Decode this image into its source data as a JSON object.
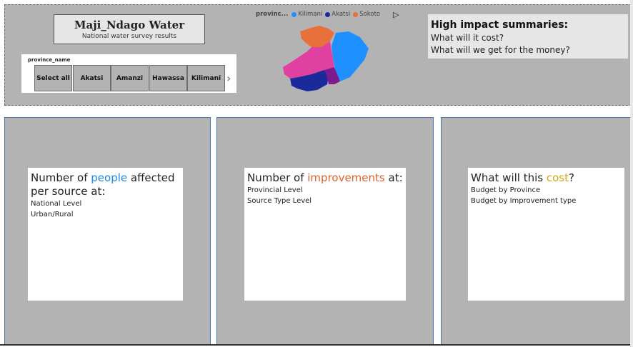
{
  "header": {
    "title": "Maji_Ndago Water",
    "subtitle": "National water survey results"
  },
  "slicer": {
    "label": "province_name",
    "options": [
      "Select all",
      "Akatsi",
      "Amanzi",
      "Hawassa",
      "Kilimani"
    ],
    "scroll_icon": "chevron-right-icon"
  },
  "map_legend": {
    "title": "provinc...",
    "items": [
      {
        "label": "Kilimani",
        "color": "#1e90ff"
      },
      {
        "label": "Akatsi",
        "color": "#1a2a9a"
      },
      {
        "label": "Sokoto",
        "color": "#e8703a"
      }
    ],
    "next_icon": "play-icon"
  },
  "map_colors": {
    "sokoto": "#e8703a",
    "kilimani": "#1e90ff",
    "pink": "#e040a0",
    "akatsi": "#1a2a9a",
    "purple": "#7a1c8c"
  },
  "summaries": {
    "title": "High impact summaries:",
    "lines": [
      "What will it cost?",
      "What will we get for the money?"
    ]
  },
  "cards": [
    {
      "head_pre": "Number of ",
      "head_hl": "people",
      "head_post": " affected per source at:",
      "lines": [
        "National Level",
        "Urban/Rural"
      ]
    },
    {
      "head_pre": "Number of ",
      "head_hl": "improvements",
      "head_post": " at:",
      "lines": [
        "Provincial Level",
        "Source Type Level"
      ]
    },
    {
      "head_pre": "What will this ",
      "head_hl": "cost",
      "head_post": "?",
      "lines": [
        "Budget by Province",
        "Budget by Improvement type"
      ]
    }
  ]
}
